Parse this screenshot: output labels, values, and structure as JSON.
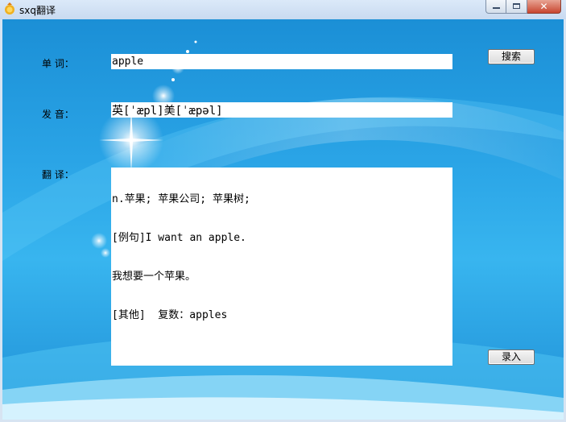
{
  "window": {
    "title": "sxq翻译"
  },
  "form": {
    "word_label": "单    词：",
    "word_value": "apple",
    "phonetic_label": "发    音：",
    "phonetic_value": "英[ˈæpl]美[ˈæpəl]",
    "translation_label": "翻    译：",
    "translation_lines": [
      "n.苹果; 苹果公司; 苹果树;",
      "[例句]I want an apple.",
      "我想要一个苹果。",
      "[其他]  复数：apples"
    ]
  },
  "buttons": {
    "search": "搜索",
    "record": "录入"
  }
}
